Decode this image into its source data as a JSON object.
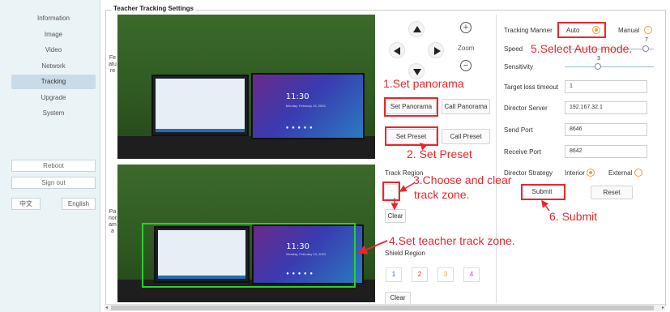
{
  "sidebar": {
    "items": [
      {
        "label": "Information"
      },
      {
        "label": "Image"
      },
      {
        "label": "Video"
      },
      {
        "label": "Network"
      },
      {
        "label": "Tracking"
      },
      {
        "label": "Upgrade"
      },
      {
        "label": "System"
      }
    ],
    "active_item": "Tracking",
    "reboot_label": "Reboot",
    "signout_label": "Sign out",
    "lang_zh": "中文",
    "lang_en": "English"
  },
  "panel": {
    "title": "Teacher Tracking Settings",
    "feature_label": "Feature",
    "panorama_label": "Panorama"
  },
  "ptz": {
    "zoom_label": "Zoom",
    "set_panorama": "Set Panorama",
    "call_panorama": "Call Panorama",
    "set_preset": "Set Preset",
    "call_preset": "Call Preset",
    "track_region_label": "Track Region",
    "clear_label": "Clear",
    "shield_region_label": "Shield Region",
    "shield_buttons": [
      "1",
      "2",
      "3",
      "4"
    ],
    "shield_colors": [
      "#3060d0",
      "#e8272b",
      "#f0a030",
      "#c040d0"
    ],
    "shield_clear_label": "Clear"
  },
  "video": {
    "clock_text": "11:30",
    "clock_sub": "Monday, February 13, 2023"
  },
  "settings": {
    "tracking_manner_label": "Tracking Manner",
    "auto_label": "Auto",
    "manual_label": "Manual",
    "speed_label": "Speed",
    "speed_value": "7",
    "sensitivity_label": "Sensitivity",
    "sensitivity_value": "3",
    "target_loss_label": "Target loss timeout",
    "target_loss_value": "1",
    "director_server_label": "Director Server",
    "director_server_value": "192.167.32.1",
    "send_port_label": "Send Port",
    "send_port_value": "8646",
    "receive_port_label": "Receive Port",
    "receive_port_value": "8642",
    "director_strategy_label": "Director Strategy",
    "interior_label": "Interior",
    "external_label": "External",
    "submit_label": "Submit",
    "reset_label": "Reset"
  },
  "annotations": {
    "step1": "1.Set panorama",
    "step2": "2. Set Preset",
    "step3a": "3.Choose and clear",
    "step3b": "track zone.",
    "step4": "4.Set teacher track zone.",
    "step5": "5.Select Auto mode.",
    "step6": "6. Submit",
    "accent_color": "#e8272b"
  }
}
